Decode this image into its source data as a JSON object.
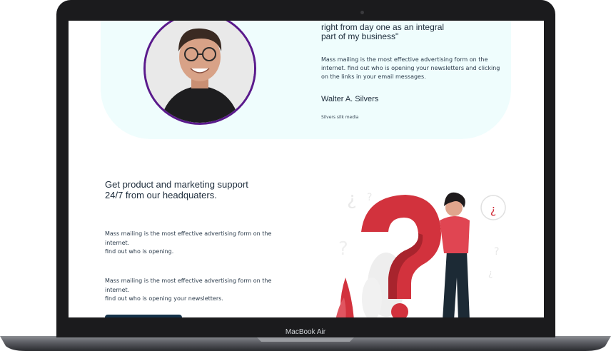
{
  "device": {
    "label": "MacBook Air"
  },
  "testimonial": {
    "quote": "right from day one as an integral\npart of my business\"",
    "body": "Mass mailing is the most effective advertising form on the internet. find out who is opening your newsletters and clicking on the links in your email messages.",
    "author": "Walter A. Silvers",
    "company": "Silvers silk media"
  },
  "support_section": {
    "heading": "Get product and marketing support 24/7 from our headquaters.",
    "paragraph_1_line_1": "Mass mailing is the most effective advertising form on the internet.",
    "paragraph_1_line_2": "find out who is opening.",
    "paragraph_2_line_1": "Mass mailing is the most effective advertising form on the internet.",
    "paragraph_2_line_2": "find out who is opening your newsletters."
  },
  "colors": {
    "hero_background": "#effdfd",
    "avatar_border": "#5a1a8c",
    "question_mark": "#d2323d",
    "button": "#14324a"
  },
  "illustration": {
    "speech_bubble_glyph": "¿"
  }
}
